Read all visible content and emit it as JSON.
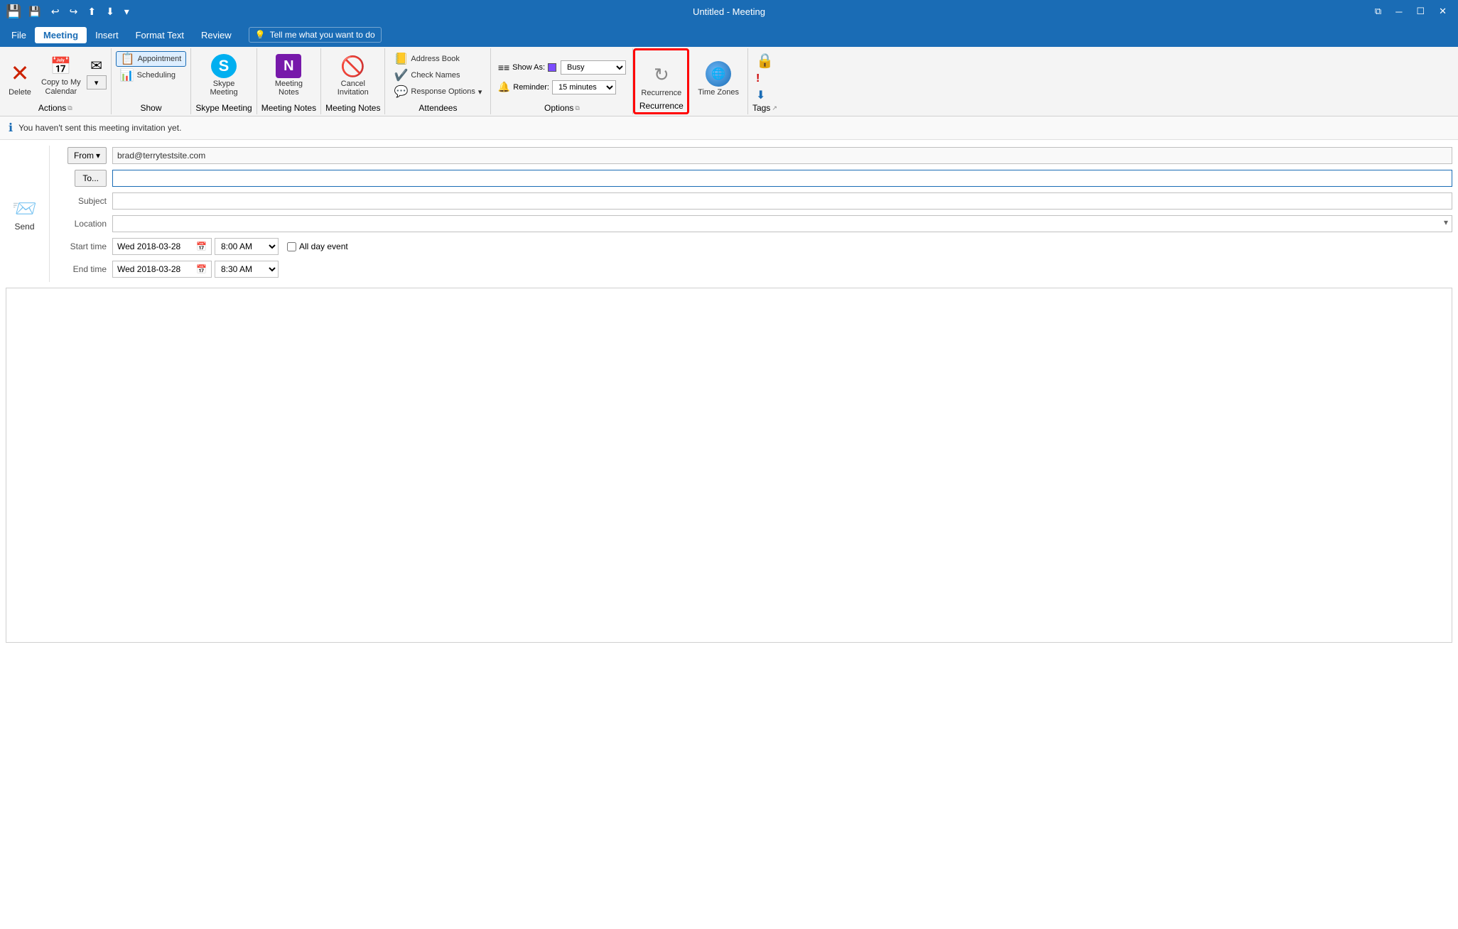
{
  "titlebar": {
    "title": "Untitled - Meeting",
    "qat": [
      "save",
      "undo",
      "redo",
      "upload",
      "download",
      "dropdown"
    ],
    "winbtns": [
      "maximize-alt",
      "minimize",
      "restore",
      "close"
    ]
  },
  "menubar": {
    "items": [
      "File",
      "Meeting",
      "Insert",
      "Format Text",
      "Review"
    ],
    "active": "Meeting",
    "tellme": "Tell me what you want to do"
  },
  "ribbon": {
    "groups": [
      {
        "name": "Actions",
        "label": "Actions",
        "buttons": [
          {
            "id": "delete",
            "label": "Delete",
            "type": "large"
          },
          {
            "id": "copy-to-my-calendar",
            "label": "Copy to My\nCalendar",
            "type": "large"
          },
          {
            "id": "forward",
            "label": "",
            "type": "large"
          }
        ]
      },
      {
        "name": "Show",
        "label": "Show",
        "buttons": [
          {
            "id": "appointment",
            "label": "Appointment",
            "type": "small",
            "highlighted": true
          },
          {
            "id": "scheduling",
            "label": "Scheduling",
            "type": "small"
          }
        ]
      },
      {
        "name": "SkypeMeeting",
        "label": "Skype Meeting",
        "buttons": [
          {
            "id": "skype-meeting",
            "label": "Skype\nMeeting",
            "type": "large"
          }
        ]
      },
      {
        "name": "MeetingNotes",
        "label": "Meeting Notes",
        "buttons": [
          {
            "id": "meeting-notes",
            "label": "Meeting\nNotes",
            "type": "large"
          }
        ]
      },
      {
        "name": "MeetingNotesGroup",
        "label": "Meeting Notes",
        "buttons": [
          {
            "id": "cancel-invitation",
            "label": "Cancel\nInvitation",
            "type": "large"
          }
        ]
      },
      {
        "name": "Attendees",
        "label": "Attendees",
        "buttons": [
          {
            "id": "address-book",
            "label": "Address Book",
            "type": "small"
          },
          {
            "id": "check-names",
            "label": "Check Names",
            "type": "small"
          },
          {
            "id": "response-options",
            "label": "Response Options",
            "type": "small",
            "dropdown": true
          }
        ]
      },
      {
        "name": "Options",
        "label": "Options",
        "showas_label": "Show As:",
        "showas_value": "Busy",
        "reminder_label": "Reminder:",
        "reminder_value": "15 minutes"
      },
      {
        "name": "Recurrence",
        "label": "Recurrence",
        "highlighted": true,
        "buttons": [
          {
            "id": "recurrence",
            "label": "Recurrence",
            "type": "large"
          }
        ]
      },
      {
        "name": "TimeZones",
        "label": "",
        "buttons": [
          {
            "id": "time-zones",
            "label": "Time\nZones",
            "type": "large"
          }
        ]
      },
      {
        "name": "Tags",
        "label": "Tags",
        "buttons": [
          {
            "id": "lock",
            "label": "",
            "type": "icon"
          },
          {
            "id": "importance-high",
            "label": "",
            "type": "icon"
          },
          {
            "id": "importance-low",
            "label": "",
            "type": "icon"
          }
        ]
      }
    ]
  },
  "infobar": {
    "text": "You haven't sent this meeting invitation yet."
  },
  "form": {
    "from_label": "From",
    "from_value": "brad@terrytestsite.com",
    "to_label": "To...",
    "to_value": "",
    "subject_label": "Subject",
    "subject_value": "",
    "location_label": "Location",
    "location_value": "",
    "start_time_label": "Start time",
    "start_date": "Wed 2018-03-28",
    "start_time": "8:00 AM",
    "all_day_label": "All day event",
    "end_time_label": "End time",
    "end_date": "Wed 2018-03-28",
    "end_time": "8:30 AM",
    "send_label": "Send"
  }
}
